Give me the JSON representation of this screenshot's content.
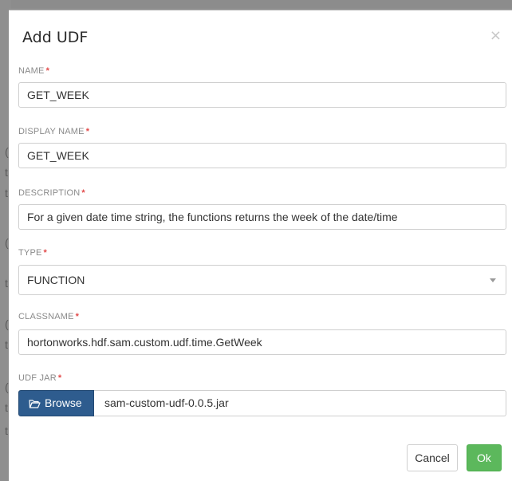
{
  "modal": {
    "title": "Add UDF",
    "close_glyph": "×"
  },
  "backdrop": {
    "chars": [
      "(",
      "t",
      "t",
      "(",
      "t",
      "(",
      "t",
      "(",
      "t",
      "t"
    ]
  },
  "form": {
    "required_mark": "*",
    "name": {
      "label": "NAME",
      "value": "GET_WEEK"
    },
    "display_name": {
      "label": "DISPLAY NAME",
      "value": "GET_WEEK"
    },
    "description": {
      "label": "DESCRIPTION",
      "value": "For a given date time string, the functions returns the week of the date/time"
    },
    "type": {
      "label": "TYPE",
      "value": "FUNCTION"
    },
    "classname": {
      "label": "CLASSNAME",
      "value": "hortonworks.hdf.sam.custom.udf.time.GetWeek"
    },
    "udf_jar": {
      "label": "UDF JAR",
      "browse_label": "Browse",
      "file_name": "sam-custom-udf-0.0.5.jar"
    }
  },
  "footer": {
    "cancel_label": "Cancel",
    "ok_label": "Ok"
  },
  "colors": {
    "primary": "#2e5c8e",
    "success": "#5cb85c",
    "required": "#e24b4b"
  }
}
